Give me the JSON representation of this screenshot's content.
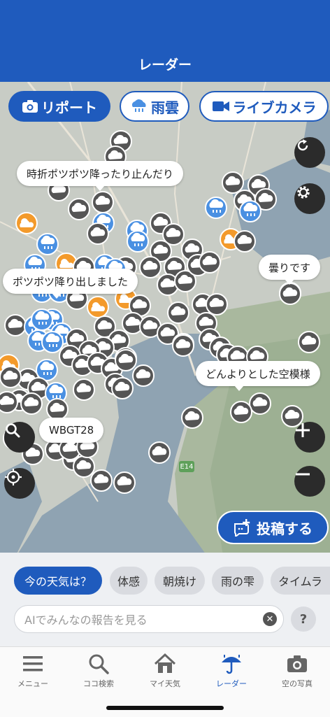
{
  "header": {
    "title": "レーダー"
  },
  "filters": [
    {
      "label": "リポート",
      "icon": "camera-icon",
      "active": true
    },
    {
      "label": "雨雲",
      "icon": "rain-cloud-icon",
      "active": false
    },
    {
      "label": "ライブカメラ",
      "icon": "video-camera-icon",
      "active": false
    }
  ],
  "callouts": [
    {
      "text": "時折ポツポツ降ったり止んだり"
    },
    {
      "text": "ポツポツ降り出しました"
    },
    {
      "text": "曇りです"
    },
    {
      "text": "どんよりとした空模様"
    },
    {
      "text": "WBGT28"
    }
  ],
  "map": {
    "road_label": "E14"
  },
  "controls": {
    "refresh_icon": "refresh-icon",
    "settings_icon": "gear-icon",
    "zoom_in_icon": "plus-icon",
    "zoom_out_icon": "minus-icon",
    "search_icon": "search-icon",
    "locate_icon": "crosshair-icon"
  },
  "post_button": {
    "label": "投稿する",
    "icon": "post-add-icon"
  },
  "chips": [
    {
      "label": "今の天気は？",
      "active": true
    },
    {
      "label": "体感",
      "active": false
    },
    {
      "label": "朝焼け",
      "active": false
    },
    {
      "label": "雨の雫",
      "active": false
    },
    {
      "label": "タイムラ",
      "active": false
    }
  ],
  "ai_search": {
    "placeholder": "AIでみんなの報告を見る",
    "value": ""
  },
  "help_label": "?",
  "tabs": [
    {
      "label": "メニュー",
      "icon": "menu-icon",
      "active": false
    },
    {
      "label": "ココ検索",
      "icon": "search-icon",
      "active": false
    },
    {
      "label": "マイ天気",
      "icon": "home-icon",
      "active": false
    },
    {
      "label": "レーダー",
      "icon": "umbrella-icon",
      "active": true
    },
    {
      "label": "空の写真",
      "icon": "camera-icon",
      "active": false
    }
  ],
  "colors": {
    "brand_blue": "#1f5bbd",
    "report_cloudy": "#555555",
    "report_rain": "#4a90e2",
    "report_sunny": "#f39a2b"
  }
}
